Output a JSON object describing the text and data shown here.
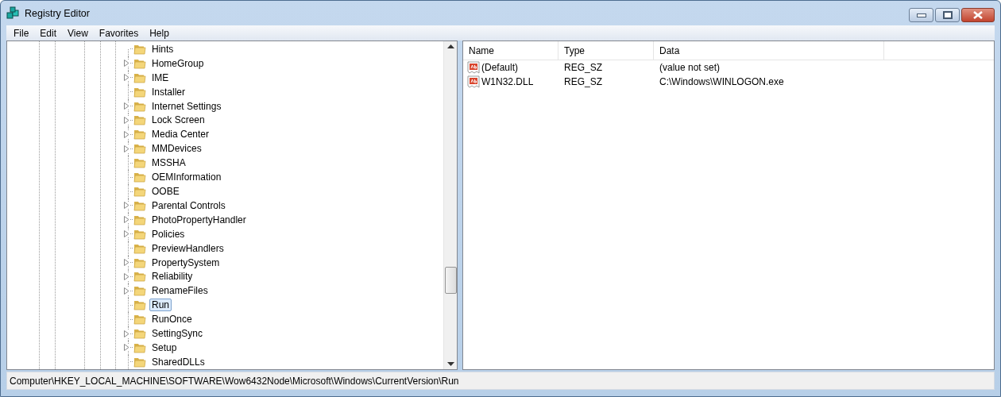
{
  "window": {
    "title": "Registry Editor"
  },
  "menu": [
    "File",
    "Edit",
    "View",
    "Favorites",
    "Help"
  ],
  "tree": {
    "items": [
      {
        "name": "Hints",
        "expandable": false,
        "selected": false
      },
      {
        "name": "HomeGroup",
        "expandable": true,
        "selected": false
      },
      {
        "name": "IME",
        "expandable": true,
        "selected": false
      },
      {
        "name": "Installer",
        "expandable": false,
        "selected": false
      },
      {
        "name": "Internet Settings",
        "expandable": true,
        "selected": false
      },
      {
        "name": "Lock Screen",
        "expandable": true,
        "selected": false
      },
      {
        "name": "Media Center",
        "expandable": true,
        "selected": false
      },
      {
        "name": "MMDevices",
        "expandable": true,
        "selected": false
      },
      {
        "name": "MSSHA",
        "expandable": false,
        "selected": false
      },
      {
        "name": "OEMInformation",
        "expandable": false,
        "selected": false
      },
      {
        "name": "OOBE",
        "expandable": false,
        "selected": false
      },
      {
        "name": "Parental Controls",
        "expandable": true,
        "selected": false
      },
      {
        "name": "PhotoPropertyHandler",
        "expandable": true,
        "selected": false
      },
      {
        "name": "Policies",
        "expandable": true,
        "selected": false
      },
      {
        "name": "PreviewHandlers",
        "expandable": false,
        "selected": false
      },
      {
        "name": "PropertySystem",
        "expandable": true,
        "selected": false
      },
      {
        "name": "Reliability",
        "expandable": true,
        "selected": false
      },
      {
        "name": "RenameFiles",
        "expandable": true,
        "selected": false
      },
      {
        "name": "Run",
        "expandable": false,
        "selected": true
      },
      {
        "name": "RunOnce",
        "expandable": false,
        "selected": false
      },
      {
        "name": "SettingSync",
        "expandable": true,
        "selected": false
      },
      {
        "name": "Setup",
        "expandable": true,
        "selected": false
      },
      {
        "name": "SharedDLLs",
        "expandable": false,
        "selected": false
      }
    ]
  },
  "values": {
    "columns": [
      "Name",
      "Type",
      "Data"
    ],
    "rows": [
      {
        "name": "(Default)",
        "type": "REG_SZ",
        "data": "(value not set)"
      },
      {
        "name": "W1N32.DLL",
        "type": "REG_SZ",
        "data": "C:\\Windows\\WINLOGON.exe"
      }
    ]
  },
  "status_bar": "Computer\\HKEY_LOCAL_MACHINE\\SOFTWARE\\Wow6432Node\\Microsoft\\Windows\\CurrentVersion\\Run"
}
